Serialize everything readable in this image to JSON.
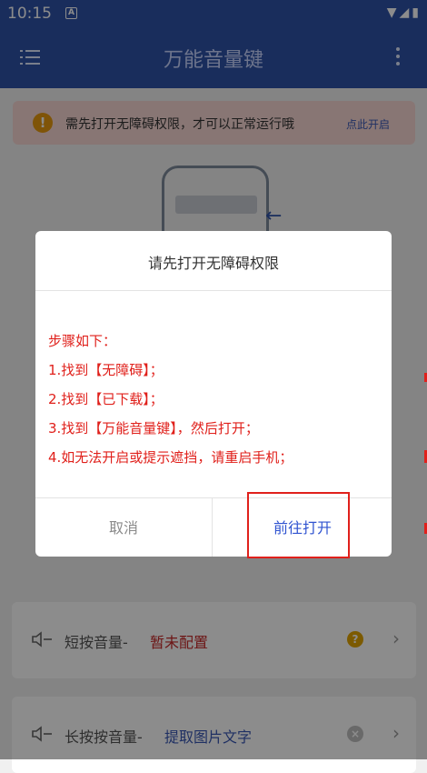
{
  "status_bar": {
    "time": "10:15",
    "notif_badge": "A",
    "icons": "▼◢▮"
  },
  "app_bar": {
    "title": "万能音量键",
    "menu_icon": "menu-icon",
    "more_icon": "more-vert-icon"
  },
  "alert": {
    "icon": "!",
    "message": "需先打开无障碍权限，才可以正常运行哦",
    "action": "点此开启"
  },
  "cards": [
    {
      "label": "短按音量-",
      "value": "暂未配置",
      "value_color": "#c62828",
      "badge": "?"
    },
    {
      "label": "长按按音量-",
      "value": "提取图片文字",
      "value_color": "#3a58b5",
      "badge": "×"
    }
  ],
  "dialog": {
    "title": "请先打开无障碍权限",
    "steps": [
      "步骤如下：",
      "1.找到【无障碍】；",
      "2.找到【已下载】；",
      "3.找到【万能音量键】，然后打开；",
      "4.如无法开启或提示遮挡，请重启手机；"
    ],
    "cancel_label": "取消",
    "confirm_label": "前往打开"
  },
  "chevron": "›",
  "arrow": "←"
}
